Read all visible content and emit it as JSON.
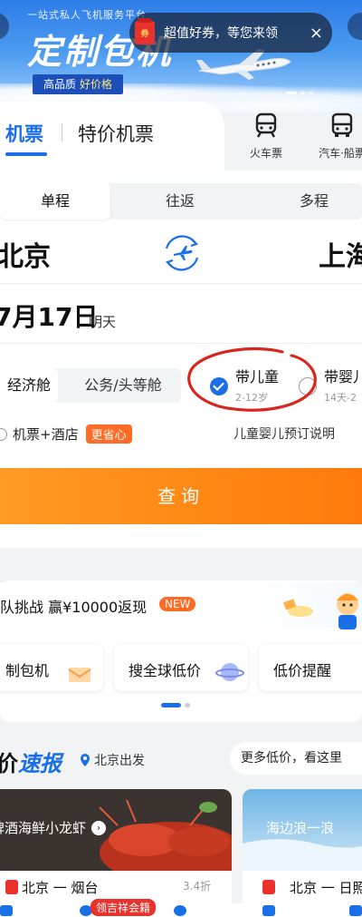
{
  "banner": {
    "subtitle": "一站式私人飞机服务平台",
    "title": "定制包机",
    "tag_main": "高品质",
    "tag_accent": "好价格",
    "coupon_icon_text": "券",
    "coupon_text": "超值好券，等您来领",
    "coupon_close": "×"
  },
  "categories": {
    "main": "机票",
    "secondary": "特价机票",
    "train": "火车票",
    "bus": "汽车·船票"
  },
  "trip_tabs": [
    "单程",
    "往返",
    "多程"
  ],
  "route": {
    "from": "北京",
    "to": "上海"
  },
  "date": {
    "value": "7月17日",
    "sub": "明天"
  },
  "cabin": [
    "经济舱",
    "公务/头等舱"
  ],
  "passenger": {
    "child_label": "带儿童",
    "child_age": "2-12岁",
    "infant_label": "带婴儿",
    "infant_age": "14天-2"
  },
  "hotel": {
    "label": "机票+酒店",
    "badge": "更省心"
  },
  "kid_note": "儿童婴儿预订说明",
  "search_button": "查询",
  "promo": {
    "text": "队挑战 赢¥10000返现",
    "badge": "NEW"
  },
  "tiles": [
    "制包机",
    "搜全球低价",
    "低价提醒"
  ],
  "deals": {
    "title_a": "价",
    "title_b": "速报",
    "location": "北京出发",
    "more": "更多低价，看这里",
    "items": [
      {
        "caption": "啤酒海鲜小龙虾",
        "arrow": "›",
        "route": "北京 一 烟台",
        "discount": "3.4折"
      },
      {
        "caption": "海边浪一浪",
        "arrow": "",
        "route": "北京 一 日照",
        "discount": ""
      }
    ]
  },
  "bottom_nav": {
    "badge": "领吉祥会籍"
  },
  "colors": {
    "primary": "#1a6fe6",
    "accent_orange": "#ff8a16",
    "badge_red": "#e8322b",
    "annotation_red": "#d8261e"
  }
}
